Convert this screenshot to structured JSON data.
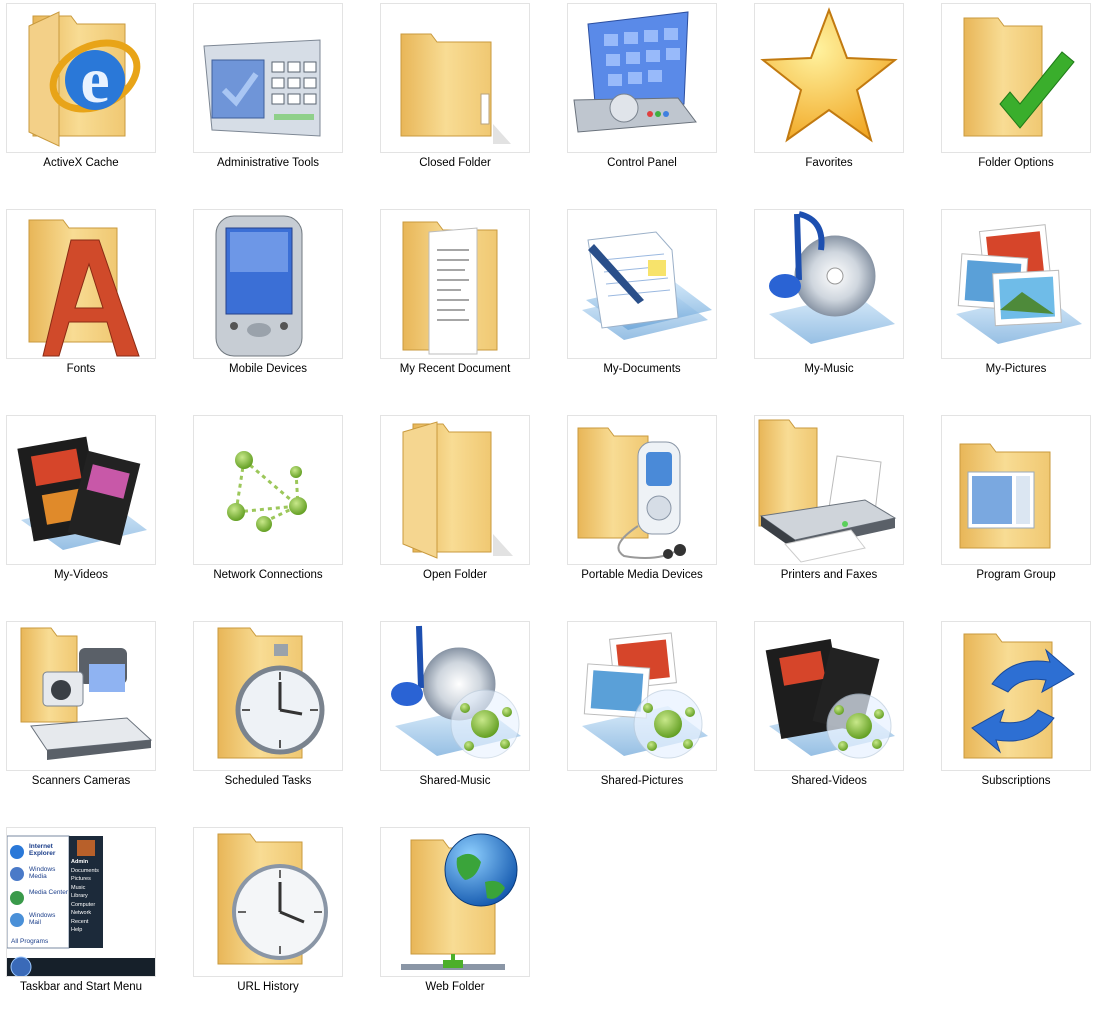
{
  "items": [
    {
      "label": "ActiveX Cache",
      "icon": "activex-cache-icon"
    },
    {
      "label": "Administrative Tools",
      "icon": "administrative-tools-icon"
    },
    {
      "label": "Closed Folder",
      "icon": "closed-folder-icon"
    },
    {
      "label": "Control Panel",
      "icon": "control-panel-icon"
    },
    {
      "label": "Favorites",
      "icon": "favorites-star-icon"
    },
    {
      "label": "Folder Options",
      "icon": "folder-options-icon"
    },
    {
      "label": "Fonts",
      "icon": "fonts-icon"
    },
    {
      "label": "Mobile Devices",
      "icon": "mobile-devices-icon"
    },
    {
      "label": "My Recent Document",
      "icon": "recent-documents-icon"
    },
    {
      "label": "My-Documents",
      "icon": "my-documents-icon"
    },
    {
      "label": "My-Music",
      "icon": "my-music-icon"
    },
    {
      "label": "My-Pictures",
      "icon": "my-pictures-icon"
    },
    {
      "label": "My-Videos",
      "icon": "my-videos-icon"
    },
    {
      "label": "Network Connections",
      "icon": "network-connections-icon"
    },
    {
      "label": "Open Folder",
      "icon": "open-folder-icon"
    },
    {
      "label": "Portable Media Devices",
      "icon": "portable-media-icon"
    },
    {
      "label": "Printers and Faxes",
      "icon": "printer-icon"
    },
    {
      "label": "Program Group",
      "icon": "program-group-icon"
    },
    {
      "label": "Scanners Cameras",
      "icon": "scanners-cameras-icon"
    },
    {
      "label": "Scheduled Tasks",
      "icon": "scheduled-tasks-icon"
    },
    {
      "label": "Shared-Music",
      "icon": "shared-music-icon"
    },
    {
      "label": "Shared-Pictures",
      "icon": "shared-pictures-icon"
    },
    {
      "label": "Shared-Videos",
      "icon": "shared-videos-icon"
    },
    {
      "label": "Subscriptions",
      "icon": "subscriptions-icon"
    },
    {
      "label": "Taskbar and Start Menu",
      "icon": "taskbar-start-menu-icon"
    },
    {
      "label": "URL History",
      "icon": "url-history-icon"
    },
    {
      "label": "Web Folder",
      "icon": "web-folder-icon"
    }
  ],
  "start_menu": {
    "left_items": [
      "Internet Explorer",
      "Windows Media",
      "Media Center",
      "Windows Mail"
    ],
    "all_programs": "All Programs",
    "right_items": [
      "Admin",
      "Documents",
      "Pictures",
      "Music",
      "Library",
      "Computer",
      "Network",
      "Recent",
      "Help"
    ]
  },
  "colors": {
    "folder": "#f2c970",
    "folder_dark": "#d9a84a",
    "accent_blue": "#2d6fd3",
    "accent_green": "#4caf2a"
  }
}
